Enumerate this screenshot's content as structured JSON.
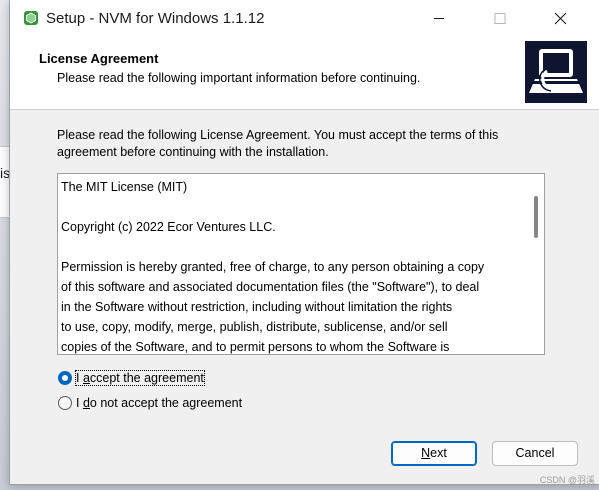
{
  "window": {
    "title": "Setup - NVM for Windows 1.1.12",
    "controls": {
      "minimize": "minimize",
      "maximize": "maximize",
      "close": "close"
    }
  },
  "background_window": {
    "partial_text": "is"
  },
  "header": {
    "title": "License Agreement",
    "subtitle": "Please read the following important information before continuing."
  },
  "body": {
    "intro": "Please read the following License Agreement. You must accept the terms of this agreement before continuing with the installation.",
    "license_text": "The MIT License (MIT)\n\nCopyright (c) 2022 Ecor Ventures LLC.\n\nPermission is hereby granted, free of charge, to any person obtaining a copy\nof this software and associated documentation files (the \"Software\"), to deal\nin the Software without restriction, including without limitation the rights\nto use, copy, modify, merge, publish, distribute, sublicense, and/or sell\ncopies of the Software, and to permit persons to whom the Software is"
  },
  "options": {
    "accept": {
      "prefix": "I ",
      "accel": "a",
      "rest": "ccept the agreement",
      "selected": true
    },
    "decline": {
      "prefix": "I ",
      "accel": "d",
      "rest": "o not accept the agreement",
      "selected": false
    }
  },
  "buttons": {
    "next_accel": "N",
    "next_rest": "ext",
    "cancel": "Cancel"
  },
  "watermark": "CSDN @羽溪",
  "colors": {
    "accent": "#0067c0",
    "window_bg": "#f0f0f0",
    "header_bg": "#ffffff",
    "wizard_image_bg": "#0d1530"
  },
  "icons": {
    "app": "nvm-setup-icon",
    "wizard": "installer-computer-icon"
  }
}
